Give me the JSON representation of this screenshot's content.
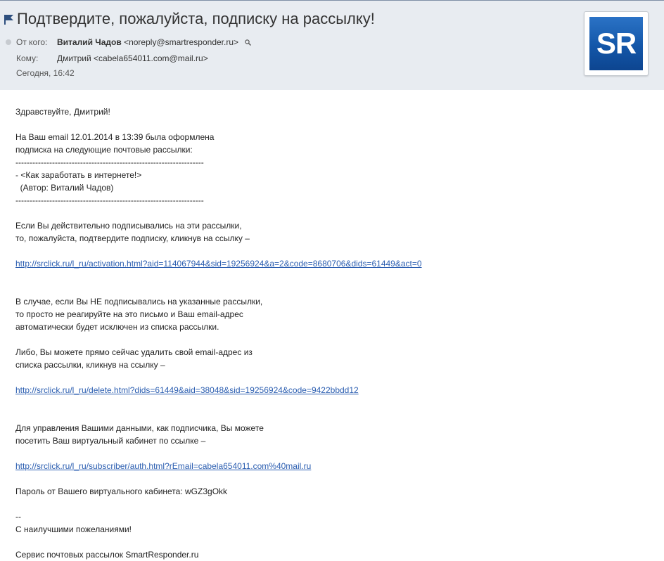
{
  "message": {
    "subject": "Подтвердите, пожалуйста, подписку на рассылку!",
    "from_label": "От кого:",
    "from_name": "Виталий Чадов",
    "from_email": "<noreply@smartresponder.ru>",
    "to_label": "Кому:",
    "to_value": "Дмитрий <cabela654011.com@mail.ru>",
    "date": "Сегодня, 16:42",
    "sender_logo": "SR"
  },
  "body": {
    "greeting": "Здравствуйте, Дмитрий!",
    "intro": "На Ваш email 12.01.2014 в 13:39 была оформлена\nподписка на следующие почтовые рассылки:\n-------------------------------------------------------------------\n- <Как заработать в интернете!>\n  (Автор: Виталий Чадов)\n-------------------------------------------------------------------",
    "confirm_text": "Если Вы действительно подписывались на эти рассылки,\nто, пожалуйста, подтвердите подписку, кликнув на ссылку –",
    "activation_link": "http://srclick.ru/l_ru/activation.html?aid=114067944&sid=19256924&a=2&code=8680706&dids=61449&act=0",
    "ignore_text": "В случае, если Вы НЕ подписывались на указанные рассылки,\nто просто не реагируйте на это письмо и Ваш email-адрес\nавтоматически будет исключен из списка рассылки.",
    "delete_text": "Либо, Вы можете прямо сейчас удалить свой email-адрес из\nсписка рассылки, кликнув на ссылку –",
    "delete_link": "http://srclick.ru/l_ru/delete.html?dids=61449&aid=38048&sid=19256924&code=9422bbdd12",
    "cabinet_text": "Для управления Вашими данными, как подписчика, Вы можете\nпосетить Ваш виртуальный кабинет по ссылке –",
    "cabinet_link": "http://srclick.ru/l_ru/subscriber/auth.html?rEmail=cabela654011.com%40mail.ru",
    "password_text": "Пароль от Вашего виртуального кабинета: wGZ3gOkk",
    "signature": "--\nС наилучшими пожеланиями!",
    "footer": "Сервис почтовых рассылок SmartResponder.ru"
  },
  "icons": {
    "flag": "flag-icon",
    "read_status": "dot-icon",
    "search": "search-icon"
  },
  "colors": {
    "header_bg": "#e8ecf1",
    "link": "#2a5db0",
    "logo_blue": "#1356a8",
    "flag": "#2e4f7e"
  }
}
